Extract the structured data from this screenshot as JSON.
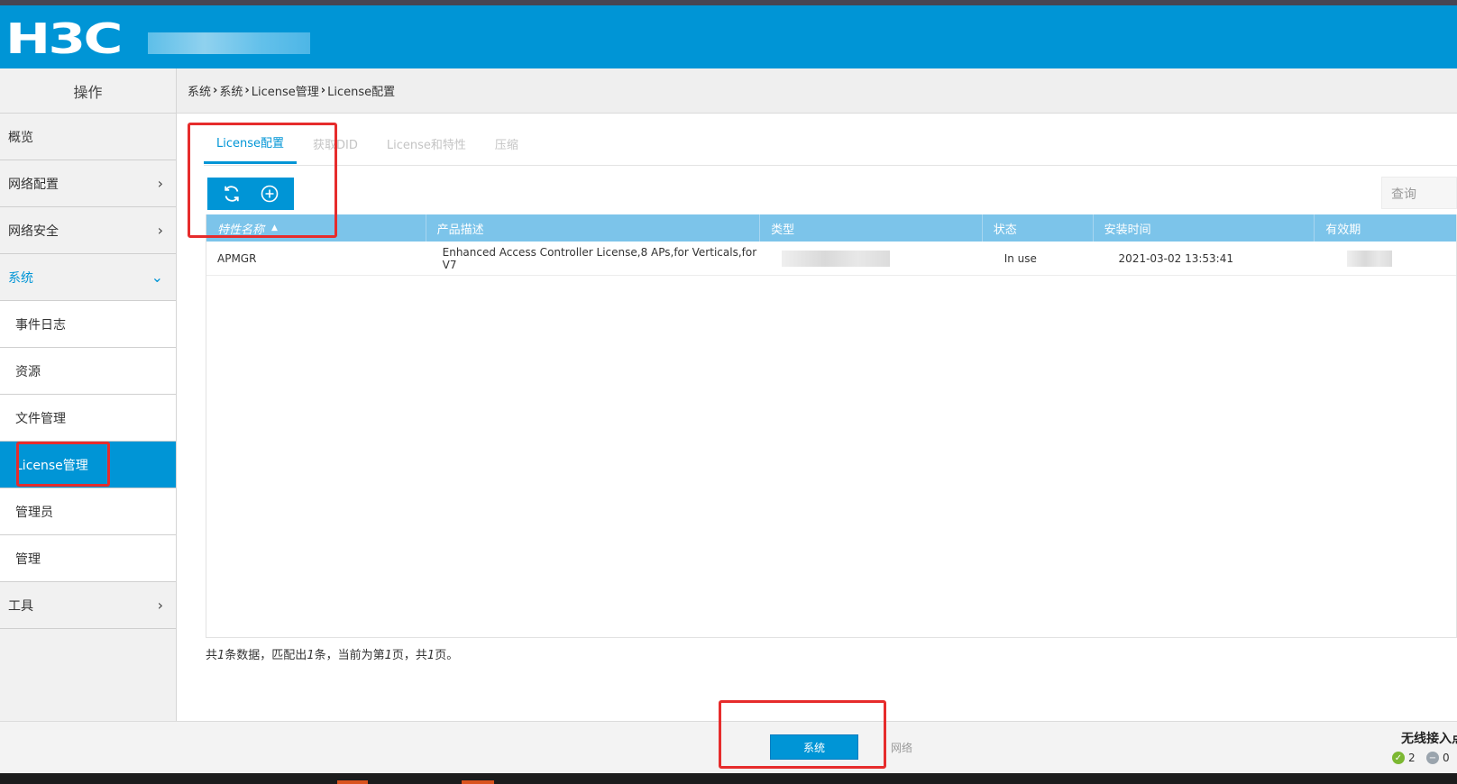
{
  "header": {
    "logo": "H3C"
  },
  "sidebar": {
    "title": "操作",
    "items": [
      {
        "label": "概览"
      },
      {
        "label": "网络配置"
      },
      {
        "label": "网络安全"
      },
      {
        "label": "系统"
      },
      {
        "label": "事件日志"
      },
      {
        "label": "资源"
      },
      {
        "label": "文件管理"
      },
      {
        "label": "License管理"
      },
      {
        "label": "管理员"
      },
      {
        "label": "管理"
      },
      {
        "label": "工具"
      }
    ]
  },
  "breadcrumb": {
    "items": [
      "系统",
      "系统",
      "License管理",
      "License配置"
    ]
  },
  "tabs": [
    {
      "label": "License配置"
    },
    {
      "label": "获取DID"
    },
    {
      "label": "License和特性"
    },
    {
      "label": "压缩"
    }
  ],
  "search": {
    "placeholder": "查询"
  },
  "table": {
    "columns": [
      "特性名称",
      "产品描述",
      "类型",
      "状态",
      "安装时间",
      "有效期"
    ],
    "rows": [
      {
        "feature": "APMGR",
        "description": "Enhanced Access Controller License,8 APs,for Verticals,for V7",
        "status": "In use",
        "installed": "2021-03-02 13:53:41"
      }
    ]
  },
  "summary": {
    "p1": "共",
    "total": "1",
    "p2": "条数据，匹配出",
    "matched": "1",
    "p3": "条，当前为第",
    "page": "1",
    "p4": "页，共",
    "pages": "1",
    "p5": "页。"
  },
  "footer": {
    "system_button": "系统",
    "network_link": "网络",
    "wireless_title": "无线接入点",
    "online_count": "2",
    "offline_count": "0"
  },
  "colors": {
    "brand": "#0095d6",
    "highlight": "#e62c2c"
  }
}
